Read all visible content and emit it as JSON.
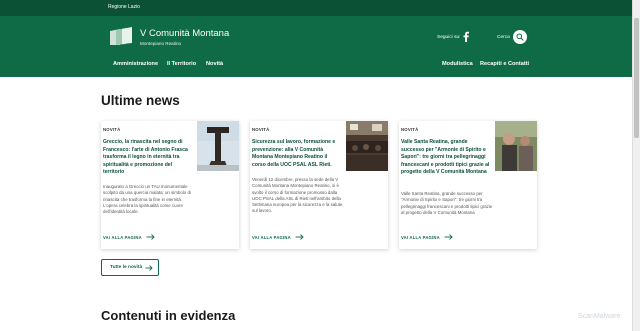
{
  "topbar": {
    "region": "Regione Lazio"
  },
  "header": {
    "brand_title": "V Comunità Montana",
    "brand_subtitle": "Montepiano Reatino",
    "social_label": "Seguici su:",
    "search_label": "Cerca"
  },
  "nav": {
    "left": [
      "Amministrazione",
      "Il Territorio",
      "Novità"
    ],
    "right": [
      "Modulistica",
      "Recapiti e Contatti"
    ]
  },
  "news_section": {
    "title": "Ultime news",
    "cards": [
      {
        "category": "NOVITÀ",
        "title": "Greccio, la rinascita nel segno di Francesco: l'arte di Antonio Frasca trasforma il legno in eternità tra spiritualità e promozione del territorio",
        "description": "Inaugurato a Greccio un TAU monumentale scolpito da una quercia malata: un simbolo di rinascita che trasforma la fine in eternità. L'opera celebra la spiritualità come cuore dell'identità locale.",
        "link_label": "VAI ALLA PAGINA"
      },
      {
        "category": "NOVITÀ",
        "title": "Sicurezza sul lavoro, formazione e prevenzione: alla V Comunità Montana Montepiano Reatino il corso della UOC PSAL ASL Rieti.",
        "description": "Venerdì 12 dicembre, presso la sede della V Comunità Montana Montepiano Reatino, si è svolto il corso di formazione promosso dalla UOC PSAL della ASL di Rieti nell'ambito della Settimana europea per la sicurezza e la salute sul lavoro.",
        "link_label": "VAI ALLA PAGINA"
      },
      {
        "category": "NOVITÀ",
        "title": "Valle Santa Reatina, grande successo per \"Armonie di Spirito e Sapori\": tre giorni tra pellegrinaggi francescani e prodotti tipici grazie al progetto della V Comunità Montana",
        "description": "Valle Santa Reatina, grande successo per \"Armonie di Spirito e Sapori\": tre giorni tra pellegrinaggi francescani e prodotti tipici grazie al progetto della V Comunità Montana",
        "link_label": "VAI ALLA PAGINA"
      }
    ],
    "all_news_label": "Tutte le novità"
  },
  "featured_section": {
    "title": "Contenuti in evidenza"
  },
  "watermark": "ScanMalware",
  "colors": {
    "brand_dark": "#0b5136",
    "brand": "#0f6b46",
    "link": "#0f6b46"
  }
}
